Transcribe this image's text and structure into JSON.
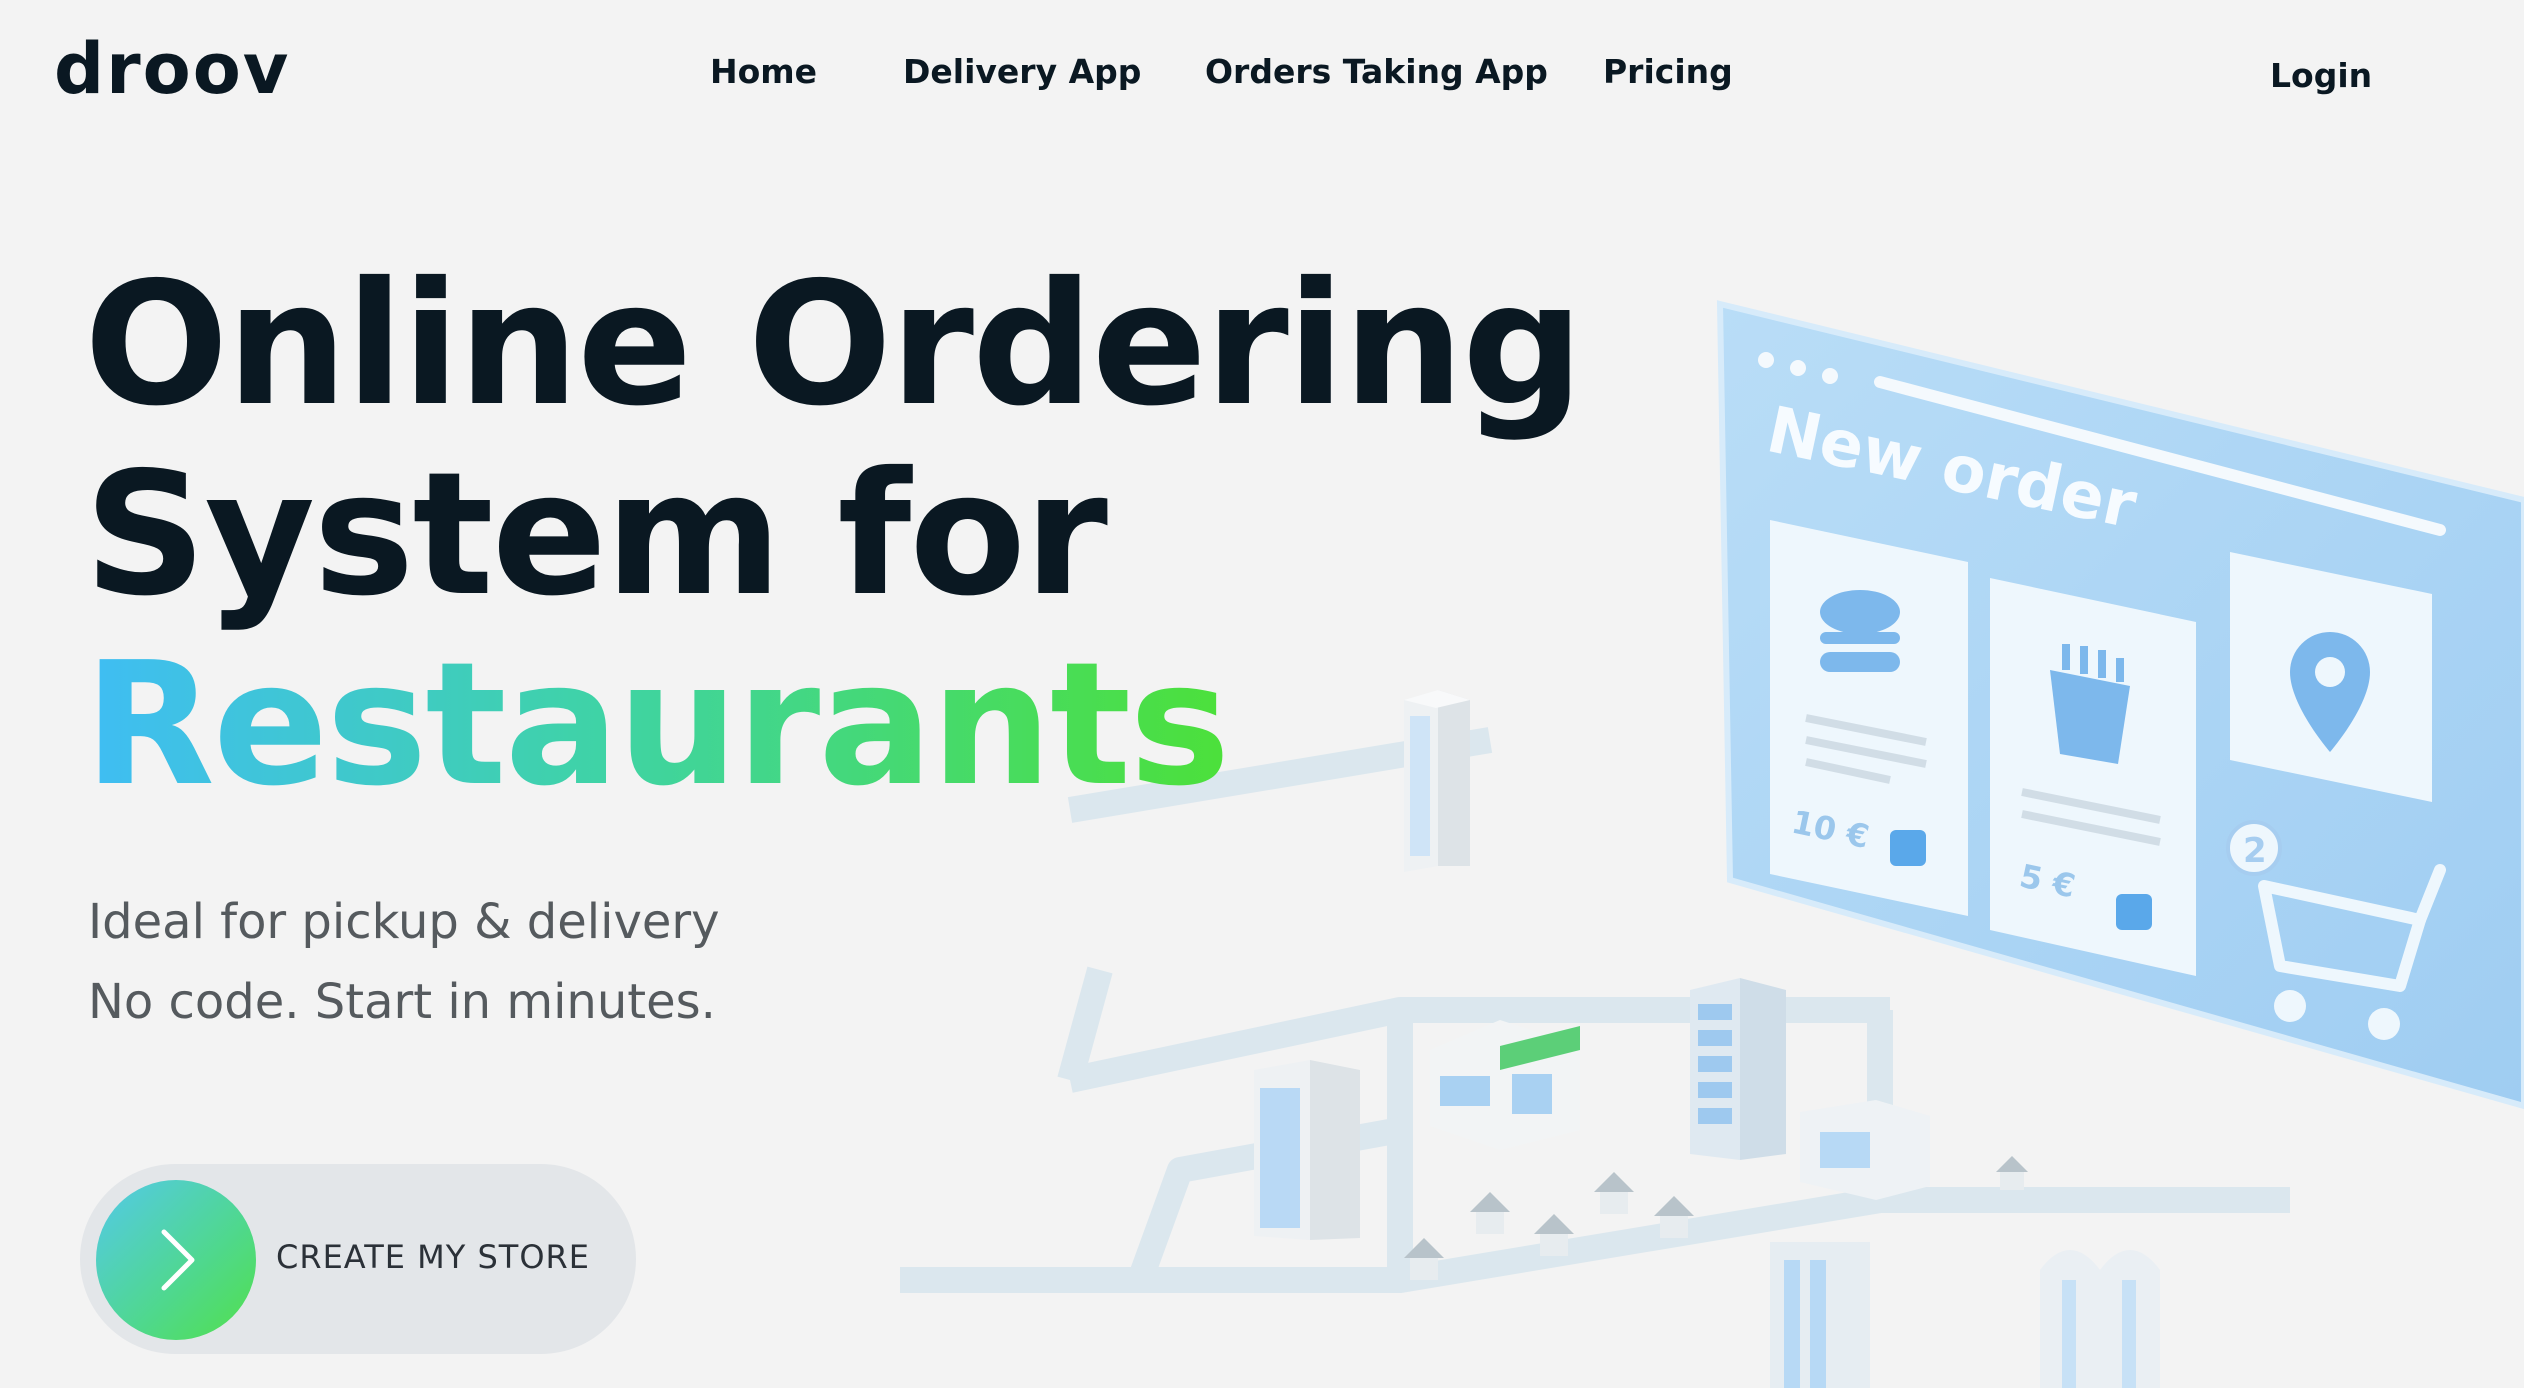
{
  "brand": {
    "logo": "droov"
  },
  "nav": {
    "links": [
      "Home",
      "Delivery App",
      "Orders Taking App",
      "Pricing"
    ],
    "login": "Login"
  },
  "hero": {
    "line1": "Online Ordering",
    "line2": "System for",
    "line3": "Restaurants",
    "sub1": "Ideal for pickup & delivery",
    "sub2": "No code. Start in minutes.",
    "cta": "CREATE MY STORE"
  },
  "illustration": {
    "heading": "New order",
    "price1": "10 €",
    "price2": "5 €",
    "cart_count": "2"
  },
  "colors": {
    "text": "#0a1822",
    "gradient_start": "#3fbdf4",
    "gradient_end": "#4ce03a",
    "panel": "#a9d4f5"
  }
}
